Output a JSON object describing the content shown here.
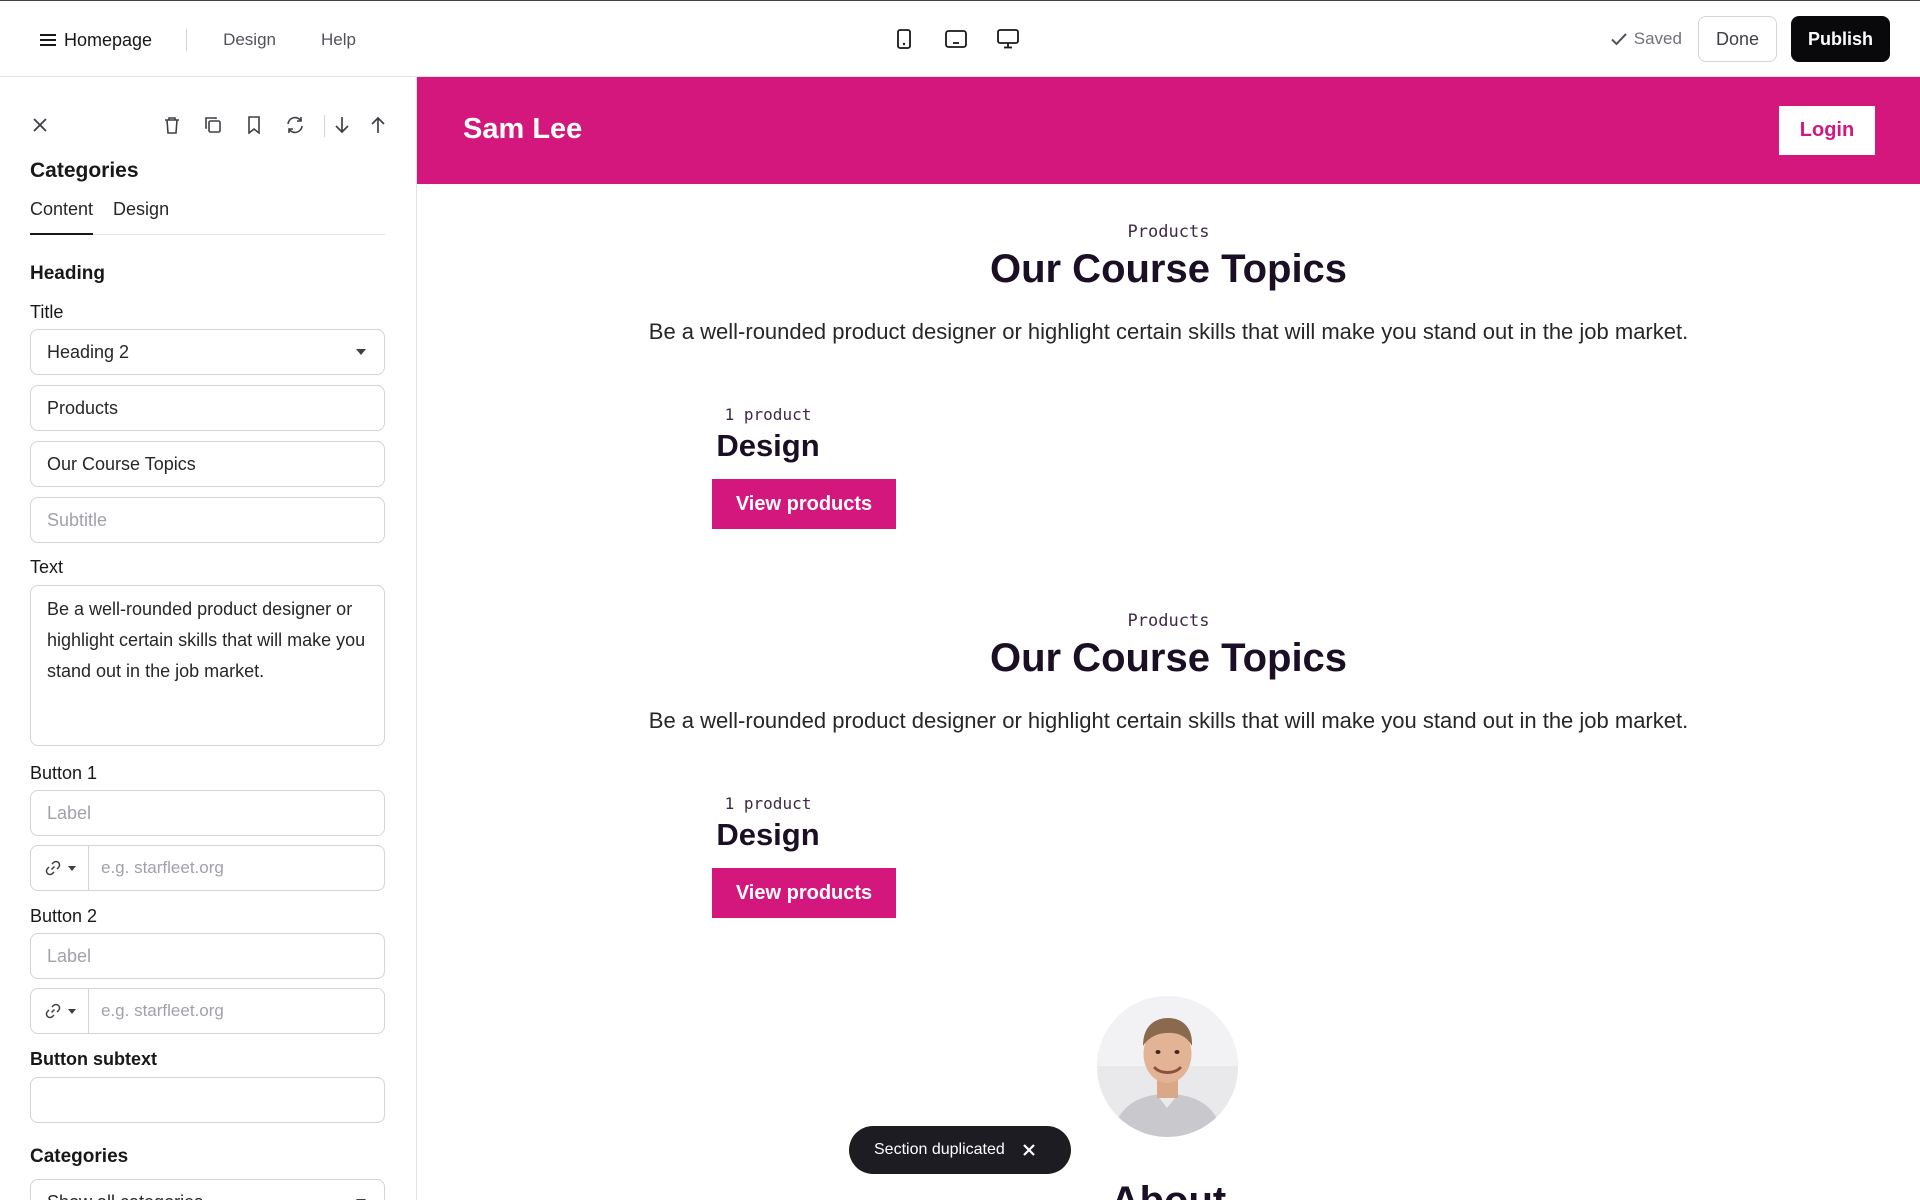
{
  "topbar": {
    "page_menu_label": "Homepage",
    "links": [
      "Design",
      "Help"
    ],
    "devices": [
      "mobile-icon",
      "tablet-icon",
      "desktop-icon"
    ],
    "saved_label": "Saved",
    "done_label": "Done",
    "publish_label": "Publish"
  },
  "sidebar": {
    "title": "Categories",
    "tabs": [
      "Content",
      "Design"
    ],
    "active_tab": "Content",
    "heading_section": "Heading",
    "title_label": "Title",
    "title_level": "Heading 2",
    "eyebrow_value": "Products",
    "heading_value": "Our Course Topics",
    "subtitle_placeholder": "Subtitle",
    "text_label": "Text",
    "text_value": "Be a well-rounded product designer or highlight certain skills that will make you stand out in the job market.",
    "button1_label": "Button 1",
    "button2_label": "Button 2",
    "label_placeholder": "Label",
    "url_placeholder": "e.g. starfleet.org",
    "button_subtext_label": "Button subtext",
    "button_subtext_value": "",
    "categories_section": "Categories",
    "categories_select": "Show all categories"
  },
  "site": {
    "brand_color": "#d3177c",
    "name": "Sam Lee",
    "login_label": "Login",
    "sections": [
      {
        "eyebrow": "Products",
        "heading": "Our Course Topics",
        "lead": "Be a well-rounded product designer or highlight certain skills that will make you stand out in the job market.",
        "card_count": "1 product",
        "card_name": "Design",
        "card_button": "View products"
      },
      {
        "eyebrow": "Products",
        "heading": "Our Course Topics",
        "lead": "Be a well-rounded product designer or highlight certain skills that will make you stand out in the job market.",
        "card_count": "1 product",
        "card_name": "Design",
        "card_button": "View products"
      }
    ],
    "about_heading_peek": "About"
  },
  "toast": {
    "message": "Section duplicated"
  },
  "help": {
    "label": "?"
  }
}
